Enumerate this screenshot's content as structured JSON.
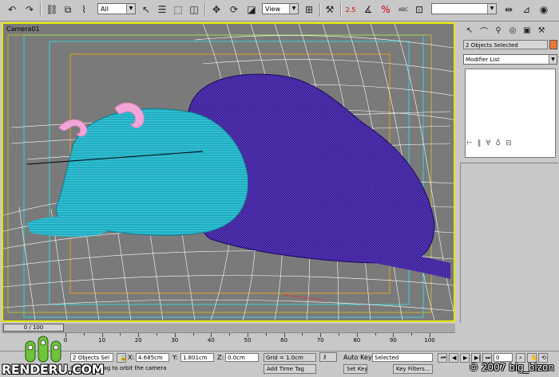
{
  "toolbar": {
    "selection_filter": "All",
    "ref_coord_system": "View",
    "angle_snap_label": "2.5",
    "percent_snap_label": "%",
    "spinner_snap_label": "ABC",
    "named_selection": ""
  },
  "viewport": {
    "label": "Camera01"
  },
  "command_panel": {
    "selection_info": "2 Objects Selected",
    "modifier_list": "Modifier List",
    "object_color": "#e8783a"
  },
  "timeline": {
    "frame_display": "0 / 100",
    "ticks": [
      "0",
      "10",
      "20",
      "30",
      "40",
      "50",
      "60",
      "70",
      "80",
      "90",
      "100"
    ]
  },
  "status": {
    "objects_selected": "2 Objects Sel",
    "x_label": "X:",
    "x_value": "4.685cm",
    "y_label": "Y:",
    "y_value": "1.801cm",
    "z_label": "Z:",
    "z_value": "0.0cm",
    "grid": "Grid = 1.0cm",
    "prompt": "Click and drag to orbit the camera",
    "add_time_tag": "Add Time Tag",
    "auto_key": "Auto Key",
    "auto_key_mode": "Selected",
    "set_key": "Set Key",
    "key_filters": "Key Filters...",
    "frame_number": "0"
  },
  "watermark": {
    "site": "RENDERU.COM",
    "copyright": "© 2007 big_bizon"
  },
  "colors": {
    "wire_white": "#ffffff",
    "body_cyan": "#1faec3",
    "fur_purple": "#3a1aa0",
    "horn_pink": "#f2a6d8",
    "safe_frame_cyan": "#36d2d8",
    "safe_frame_orange": "#e0a020",
    "viewport_border": "#e6e600"
  }
}
